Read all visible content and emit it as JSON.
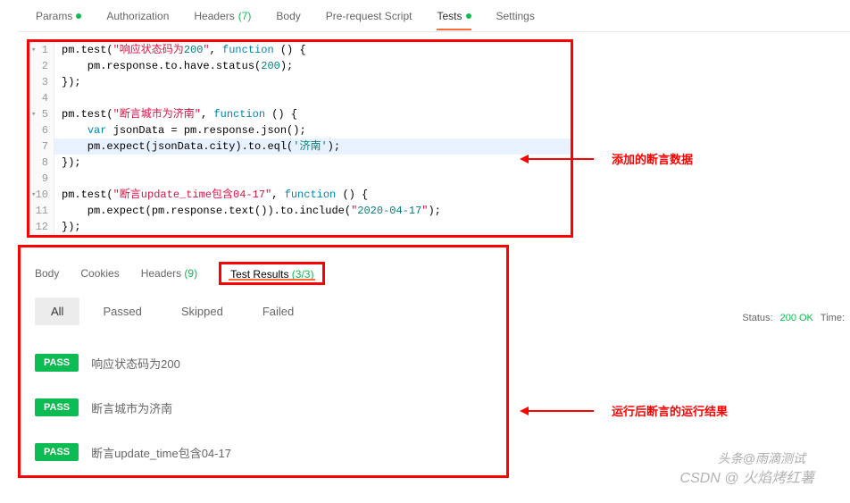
{
  "top_tabs": {
    "params": "Params",
    "auth": "Authorization",
    "headers": "Headers",
    "headers_count": "(7)",
    "body": "Body",
    "prereq": "Pre-request Script",
    "tests": "Tests",
    "settings": "Settings"
  },
  "code": {
    "lines": [
      {
        "n": "1",
        "t": "pm.test(\"响应状态码为200\", function () {",
        "fold": true
      },
      {
        "n": "2",
        "t": "    pm.response.to.have.status(200);"
      },
      {
        "n": "3",
        "t": "});"
      },
      {
        "n": "4",
        "t": ""
      },
      {
        "n": "5",
        "t": "pm.test(\"断言城市为济南\", function () {",
        "fold": true
      },
      {
        "n": "6",
        "t": "    var jsonData = pm.response.json();"
      },
      {
        "n": "7",
        "t": "    pm.expect(jsonData.city).to.eql('济南');",
        "hl": true
      },
      {
        "n": "8",
        "t": "});"
      },
      {
        "n": "9",
        "t": ""
      },
      {
        "n": "10",
        "t": "pm.test(\"断言update_time包含04-17\", function () {",
        "fold": true
      },
      {
        "n": "11",
        "t": "    pm.expect(pm.response.text()).to.include(\"2020-04-17\");"
      },
      {
        "n": "12",
        "t": "});"
      }
    ]
  },
  "annotations": {
    "a1": "添加的断言数据",
    "a2": "运行后断言的运行结果"
  },
  "results_tabs": {
    "body": "Body",
    "cookies": "Cookies",
    "headers": "Headers",
    "headers_count": "(9)",
    "testres": "Test Results",
    "testres_count": "(3/3)"
  },
  "status": {
    "label": "Status:",
    "value": "200 OK",
    "time_label": "Time:"
  },
  "filters": {
    "all": "All",
    "passed": "Passed",
    "skipped": "Skipped",
    "failed": "Failed"
  },
  "tests": [
    {
      "badge": "PASS",
      "name": "响应状态码为200"
    },
    {
      "badge": "PASS",
      "name": "断言城市为济南"
    },
    {
      "badge": "PASS",
      "name": "断言update_time包含04-17"
    }
  ],
  "watermark": {
    "w1": "头条@雨滴测试",
    "w2": "CSDN @ 火焰烤红薯"
  }
}
